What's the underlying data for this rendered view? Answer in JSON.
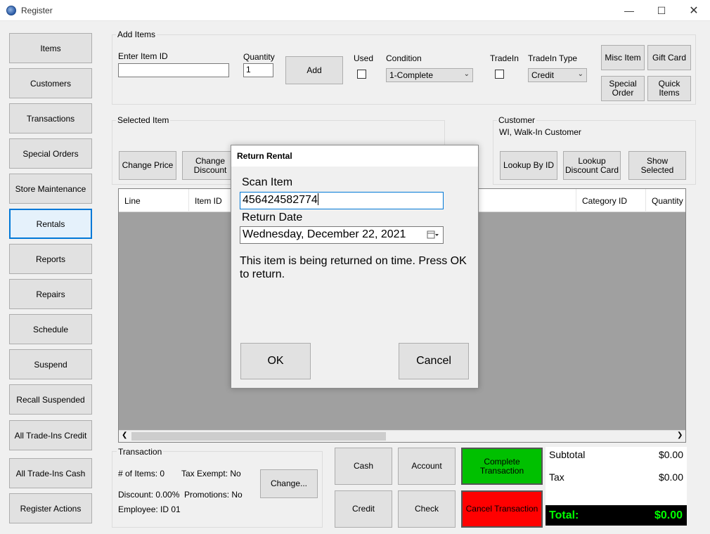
{
  "window": {
    "title": "Register"
  },
  "sidebar": {
    "items": [
      {
        "label": "Items"
      },
      {
        "label": "Customers"
      },
      {
        "label": "Transactions"
      },
      {
        "label": "Special Orders"
      },
      {
        "label": "Store Maintenance"
      },
      {
        "label": "Rentals"
      },
      {
        "label": "Reports"
      },
      {
        "label": "Repairs"
      },
      {
        "label": "Schedule"
      },
      {
        "label": "Suspend"
      },
      {
        "label": "Recall Suspended"
      },
      {
        "label": "All Trade-Ins Credit"
      },
      {
        "label": "All Trade-Ins Cash"
      },
      {
        "label": "Register Actions"
      }
    ],
    "active": "Rentals"
  },
  "add_items": {
    "group_label": "Add Items",
    "item_id_label": "Enter Item ID",
    "item_id_value": "",
    "quantity_label": "Quantity",
    "quantity_value": "1",
    "add_button": "Add",
    "used_label": "Used",
    "condition_label": "Condition",
    "condition_value": "1-Complete",
    "tradein_label": "TradeIn",
    "tradein_type_label": "TradeIn Type",
    "tradein_type_value": "Credit",
    "misc_item_button": "Misc Item",
    "gift_card_button": "Gift Card",
    "special_order_button": "Special Order",
    "quick_items_button": "Quick Items"
  },
  "selected_item": {
    "group_label": "Selected Item",
    "change_price_button": "Change Price",
    "change_discount_button": "Change Discount"
  },
  "customer": {
    "group_label": "Customer",
    "name": "WI, Walk-In Customer",
    "lookup_by_id_button": "Lookup By ID",
    "lookup_discount_card_button": "Lookup Discount Card",
    "show_selected_button": "Show Selected"
  },
  "grid": {
    "columns": [
      "Line",
      "Item ID",
      "Category ID",
      "Quantity"
    ],
    "rows": []
  },
  "transaction": {
    "group_label": "Transaction",
    "num_items": "# of Items: 0",
    "tax_exempt": "Tax Exempt: No",
    "discount": "Discount: 0.00%",
    "promotions": "Promotions: No",
    "employee": "Employee: ID 01",
    "change_button": "Change..."
  },
  "payment": {
    "cash_button": "Cash",
    "account_button": "Account",
    "credit_button": "Credit",
    "check_button": "Check",
    "complete_button": "Complete Transaction",
    "cancel_button": "Cancel Transaction"
  },
  "totals": {
    "subtotal_label": "Subtotal",
    "subtotal_value": "$0.00",
    "tax_label": "Tax",
    "tax_value": "$0.00",
    "total_label": "Total:",
    "total_value": "$0.00"
  },
  "dialog": {
    "title": "Return Rental",
    "scan_item_label": "Scan Item",
    "scan_item_value": "456424582774",
    "return_date_label": "Return Date",
    "return_date_value": "Wednesday, December 22, 2021",
    "message": "This item is being returned on time.  Press OK to return.",
    "ok_button": "OK",
    "cancel_button": "Cancel"
  },
  "colors": {
    "accent": "#0078d7",
    "complete_green": "#00c000",
    "cancel_red": "#ff0000",
    "total_text_green": "#00ff00",
    "grid_background": "#a0a0a0"
  },
  "icons": {
    "app": "register-app-icon",
    "minimize": "minimize-icon",
    "maximize": "maximize-icon",
    "close": "close-icon",
    "dropdown": "chevron-down-icon",
    "calendar": "calendar-icon"
  }
}
